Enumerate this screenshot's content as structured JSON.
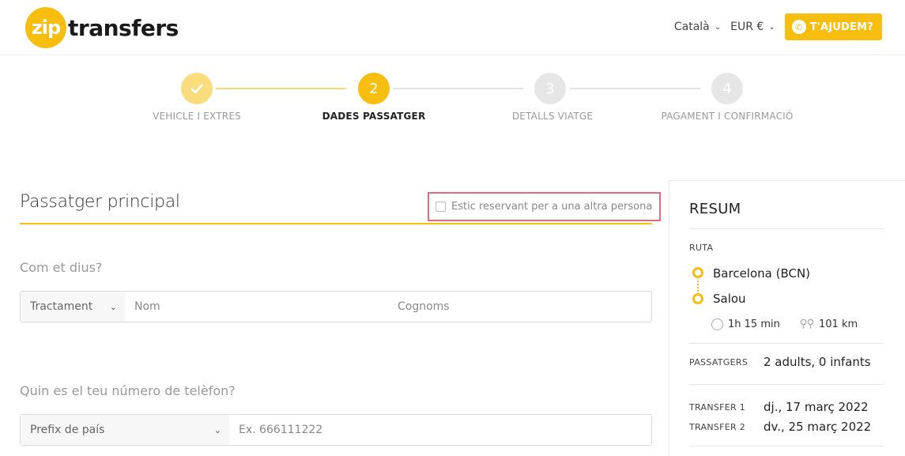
{
  "brand": {
    "badge": "zip",
    "word": "transfers"
  },
  "header": {
    "language": "Català",
    "currency": "EUR €",
    "help_label": "T'AJUDEM?"
  },
  "stepper": {
    "steps": [
      {
        "label": "VEHICLE I EXTRES",
        "number": "1",
        "state": "done"
      },
      {
        "label": "DADES PASSATGER",
        "number": "2",
        "state": "active"
      },
      {
        "label": "DETALLS VIATGE",
        "number": "3",
        "state": "todo"
      },
      {
        "label": "PAGAMENT I CONFIRMACIÓ",
        "number": "4",
        "state": "todo"
      }
    ]
  },
  "form": {
    "title": "Passatger principal",
    "other_person_label": "Estic reservant per a una altra persona",
    "other_person_checked": false,
    "name_question": "Com et dius?",
    "title_select": "Tractament",
    "first_name_placeholder": "Nom",
    "last_name_placeholder": "Cognoms",
    "phone_question": "Quin es el teu número de telèfon?",
    "country_prefix_select": "Prefix de país",
    "phone_placeholder": "Ex. 666111222"
  },
  "summary": {
    "title": "RESUM",
    "route_label": "RUTA",
    "origin": "Barcelona (BCN)",
    "destination": "Salou",
    "duration": "1h 15 min",
    "distance": "101 km",
    "passengers_label": "PASSATGERS",
    "passengers_value": "2 adults, 0 infants",
    "transfer1_label": "TRANSFER 1",
    "transfer1_value": "dj., 17 març 2022",
    "transfer2_label": "TRANSFER 2",
    "transfer2_value": "dv., 25 març 2022"
  },
  "colors": {
    "accent": "#f7bd0f",
    "highlight_border": "#e26a7a"
  }
}
